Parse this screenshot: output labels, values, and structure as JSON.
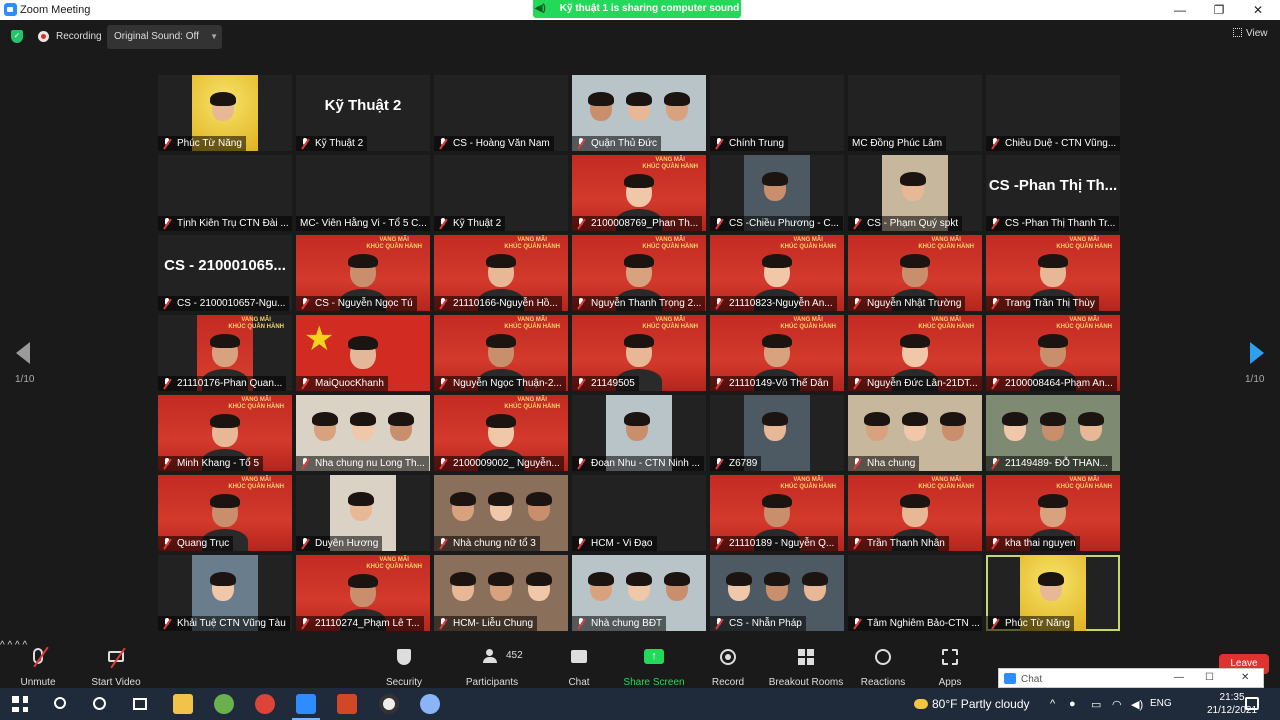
{
  "window": {
    "title": "Zoom Meeting",
    "sharing_banner": "Kỹ thuật 1 is sharing computer sound"
  },
  "statusbar": {
    "recording_label": "Recording",
    "original_sound": "Original Sound: Off",
    "view_label": "View"
  },
  "pager": {
    "left_label": "1/10",
    "right_label": "1/10"
  },
  "tiles": [
    {
      "label": "Phúc Từ Năng",
      "muted": true,
      "type": "photo"
    },
    {
      "label": "Kỹ Thuật 2",
      "muted": true,
      "type": "name",
      "big": "Kỹ Thuật 2"
    },
    {
      "label": "CS - Hoàng Văn Nam",
      "muted": true,
      "type": "blank"
    },
    {
      "label": "Quận Thủ Đức",
      "muted": true,
      "type": "photo"
    },
    {
      "label": "Chính Trung",
      "muted": true,
      "type": "blank"
    },
    {
      "label": "MC Đồng Phúc Lâm",
      "muted": false,
      "type": "blank"
    },
    {
      "label": "Chiều Duệ - CTN Vũng...",
      "muted": true,
      "type": "blank"
    },
    {
      "label": "Tịnh Kiên Trụ  CTN Đài ...",
      "muted": true,
      "type": "blank"
    },
    {
      "label": "MC- Viên Hằng Vi - Tổ 5 C...",
      "muted": false,
      "type": "blank"
    },
    {
      "label": "Kỹ Thuật 2",
      "muted": true,
      "type": "blank"
    },
    {
      "label": "2100008769_Phan Th...",
      "muted": true,
      "type": "red"
    },
    {
      "label": "CS -Chiều Phương - C...",
      "muted": true,
      "type": "photo"
    },
    {
      "label": "CS - Phạm Quý spkt",
      "muted": true,
      "type": "photo"
    },
    {
      "label": "CS -Phan Thị Thanh Tr...",
      "muted": true,
      "type": "name",
      "big": "CS -Phan Thị Th..."
    },
    {
      "label": "CS - 2100010657-Ngu...",
      "muted": true,
      "type": "name",
      "big": "CS - 210001065..."
    },
    {
      "label": "CS - Nguyễn Ngọc Tú",
      "muted": true,
      "type": "red"
    },
    {
      "label": "21110166-Nguyễn Hồ...",
      "muted": true,
      "type": "red"
    },
    {
      "label": "Nguyễn Thanh Trọng 2...",
      "muted": true,
      "type": "red"
    },
    {
      "label": "21110823-Nguyễn An...",
      "muted": true,
      "type": "red"
    },
    {
      "label": "Nguyễn Nhật Trường",
      "muted": true,
      "type": "red"
    },
    {
      "label": "Trang Trần Thị Thùy",
      "muted": true,
      "type": "red"
    },
    {
      "label": "21110176-Phan Quan...",
      "muted": true,
      "type": "redsmall"
    },
    {
      "label": "MaiQuocKhanh",
      "muted": true,
      "type": "flag"
    },
    {
      "label": "Nguyễn Ngọc Thuận-2...",
      "muted": true,
      "type": "red"
    },
    {
      "label": "21149505",
      "muted": true,
      "type": "red"
    },
    {
      "label": "21110149-Võ Thế Dân",
      "muted": true,
      "type": "red"
    },
    {
      "label": "Nguyễn Đức Lân-21DT...",
      "muted": true,
      "type": "red"
    },
    {
      "label": "2100008464-Phạm An...",
      "muted": true,
      "type": "red"
    },
    {
      "label": "Minh Khang - Tổ 5",
      "muted": true,
      "type": "red"
    },
    {
      "label": "Nha chung nu Long Th...",
      "muted": true,
      "type": "photo"
    },
    {
      "label": "2100009002_ Nguyễn...",
      "muted": true,
      "type": "red"
    },
    {
      "label": "Đoan Nhu - CTN Ninh ...",
      "muted": true,
      "type": "photo"
    },
    {
      "label": "Z6789",
      "muted": true,
      "type": "photo"
    },
    {
      "label": "Nha chung",
      "muted": true,
      "type": "photo"
    },
    {
      "label": "21149489- ĐỖ THAN...",
      "muted": true,
      "type": "photo"
    },
    {
      "label": "Quang Trục",
      "muted": true,
      "type": "red"
    },
    {
      "label": "Duyên Hương",
      "muted": true,
      "type": "photo"
    },
    {
      "label": "Nhà chung nữ tổ 3",
      "muted": true,
      "type": "photo"
    },
    {
      "label": "HCM - Vi Đạo",
      "muted": true,
      "type": "blank"
    },
    {
      "label": "21110189 - Nguyễn Q...",
      "muted": true,
      "type": "red"
    },
    {
      "label": "Trần Thanh Nhân",
      "muted": true,
      "type": "red"
    },
    {
      "label": "kha thai nguyen",
      "muted": true,
      "type": "red"
    },
    {
      "label": "Khải Tuệ CTN Vũng Tàu",
      "muted": true,
      "type": "photo"
    },
    {
      "label": "21110274_Phạm Lê T...",
      "muted": true,
      "type": "red"
    },
    {
      "label": "HCM- Liễu Chung",
      "muted": true,
      "type": "photo"
    },
    {
      "label": "Nhà chung BĐT",
      "muted": true,
      "type": "photo"
    },
    {
      "label": "CS - Nhẫn Pháp",
      "muted": true,
      "type": "photo"
    },
    {
      "label": "Tâm Nghiêm Bảo-CTN ...",
      "muted": true,
      "type": "blank"
    },
    {
      "label": "Phúc Từ Năng",
      "muted": true,
      "type": "photo",
      "active": true
    }
  ],
  "banner_text": "VANG MÃI\nKHÚC QUÂN HÀNH",
  "toolbar": {
    "unmute": "Unmute",
    "start_video": "Start Video",
    "security": "Security",
    "participants": "Participants",
    "participants_count": "452",
    "chat": "Chat",
    "share_screen": "Share Screen",
    "record": "Record",
    "breakout_rooms": "Breakout Rooms",
    "reactions": "Reactions",
    "apps": "Apps",
    "leave": "Leave"
  },
  "chat_popup": {
    "title": "Chat"
  },
  "taskbar": {
    "weather": "80°F  Partly cloudy",
    "language": "ENG",
    "time": "21:35",
    "date": "21/12/2021"
  },
  "colors": {
    "accent_share": "#23d959",
    "tile_red": "#c32a22",
    "active_border": "#c6d86b",
    "leave": "#e0322f"
  }
}
